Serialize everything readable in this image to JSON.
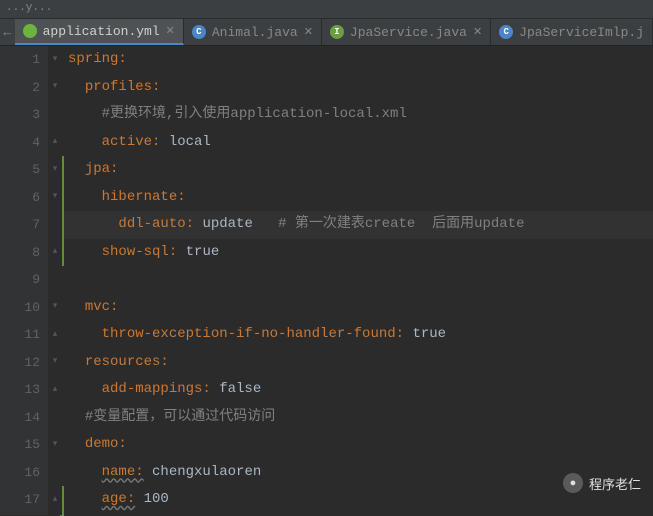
{
  "breadcrumb": "...y...",
  "tabs": [
    {
      "label": "application.yml",
      "iconClass": "fi-spring",
      "iconGlyph": "",
      "active": true
    },
    {
      "label": "Animal.java",
      "iconClass": "fi-class",
      "iconGlyph": "C",
      "active": false
    },
    {
      "label": "JpaService.java",
      "iconClass": "fi-iface",
      "iconGlyph": "I",
      "active": false
    },
    {
      "label": "JpaServiceImlp.j",
      "iconClass": "fi-class",
      "iconGlyph": "C",
      "active": false
    }
  ],
  "lines": {
    "l1_key": "spring:",
    "l2_key": "profiles:",
    "l3_comment": "#更换环境,引入使用application-local.xml",
    "l4_key": "active:",
    "l4_val": " local",
    "l5_key": "jpa:",
    "l6_key": "hibernate:",
    "l7_key": "ddl-auto:",
    "l7_val": " update",
    "l7_comment": "   # 第一次建表create  后面用update",
    "l8_key": "show-sql:",
    "l8_val": " true",
    "l10_key": "mvc:",
    "l11_key": "throw-exception-if-no-handler-found:",
    "l11_val": " true",
    "l12_key": "resources:",
    "l13_key": "add-mappings:",
    "l13_val": " false",
    "l14_comment": "#变量配置，可以通过代码访问",
    "l15_key": "demo:",
    "l16_key": "name:",
    "l16_val": " chengxulaoren",
    "l17_key": "age:",
    "l17_val": " 100"
  },
  "line_numbers": [
    "1",
    "2",
    "3",
    "4",
    "5",
    "6",
    "7",
    "8",
    "9",
    "10",
    "11",
    "12",
    "13",
    "14",
    "15",
    "16",
    "17"
  ],
  "watermark": "程序老仁"
}
